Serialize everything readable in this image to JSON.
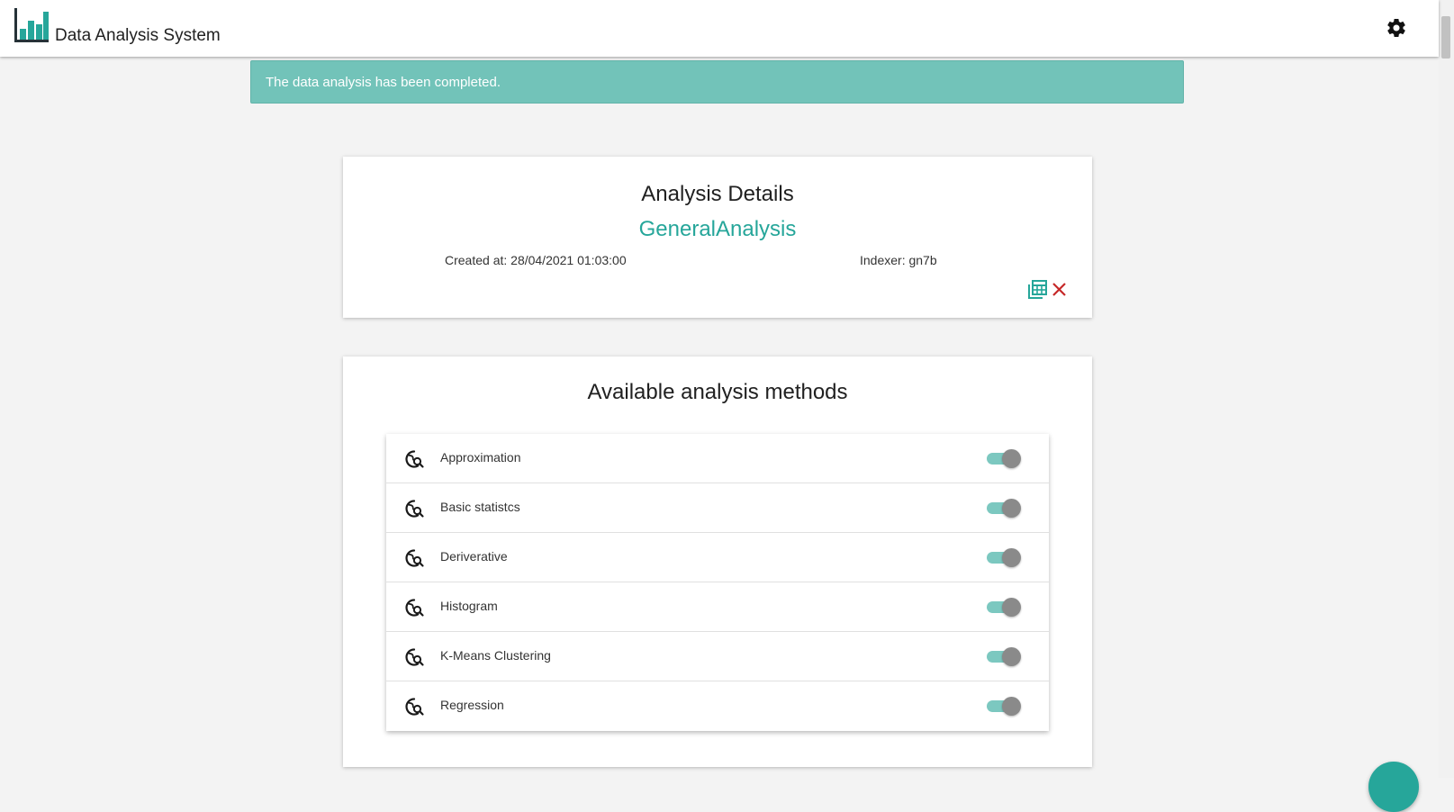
{
  "header": {
    "app_title": "Data Analysis System",
    "logo_icon": "bar-chart-icon",
    "settings_icon": "gear-icon"
  },
  "alert": {
    "message": "The data analysis has been completed."
  },
  "details": {
    "title": "Analysis Details",
    "name": "GeneralAnalysis",
    "created": "Created at: 28/04/2021 01:03:00",
    "indexer": "Indexer: gn7b",
    "actions": [
      "table-export-icon",
      "close-icon"
    ]
  },
  "methods": {
    "title": "Available analysis methods",
    "items": [
      {
        "label": "Approximation",
        "enabled": true
      },
      {
        "label": "Basic statistcs",
        "enabled": true
      },
      {
        "label": "Deriverative",
        "enabled": true
      },
      {
        "label": "Histogram",
        "enabled": true
      },
      {
        "label": "K-Means Clustering",
        "enabled": true
      },
      {
        "label": "Regression",
        "enabled": true
      }
    ]
  },
  "colors": {
    "accent": "#26a69a",
    "alert_bg": "#72c3b9",
    "danger": "#c62828",
    "switch_track": "#7cc8c0",
    "switch_knob": "#8a8a8a"
  }
}
